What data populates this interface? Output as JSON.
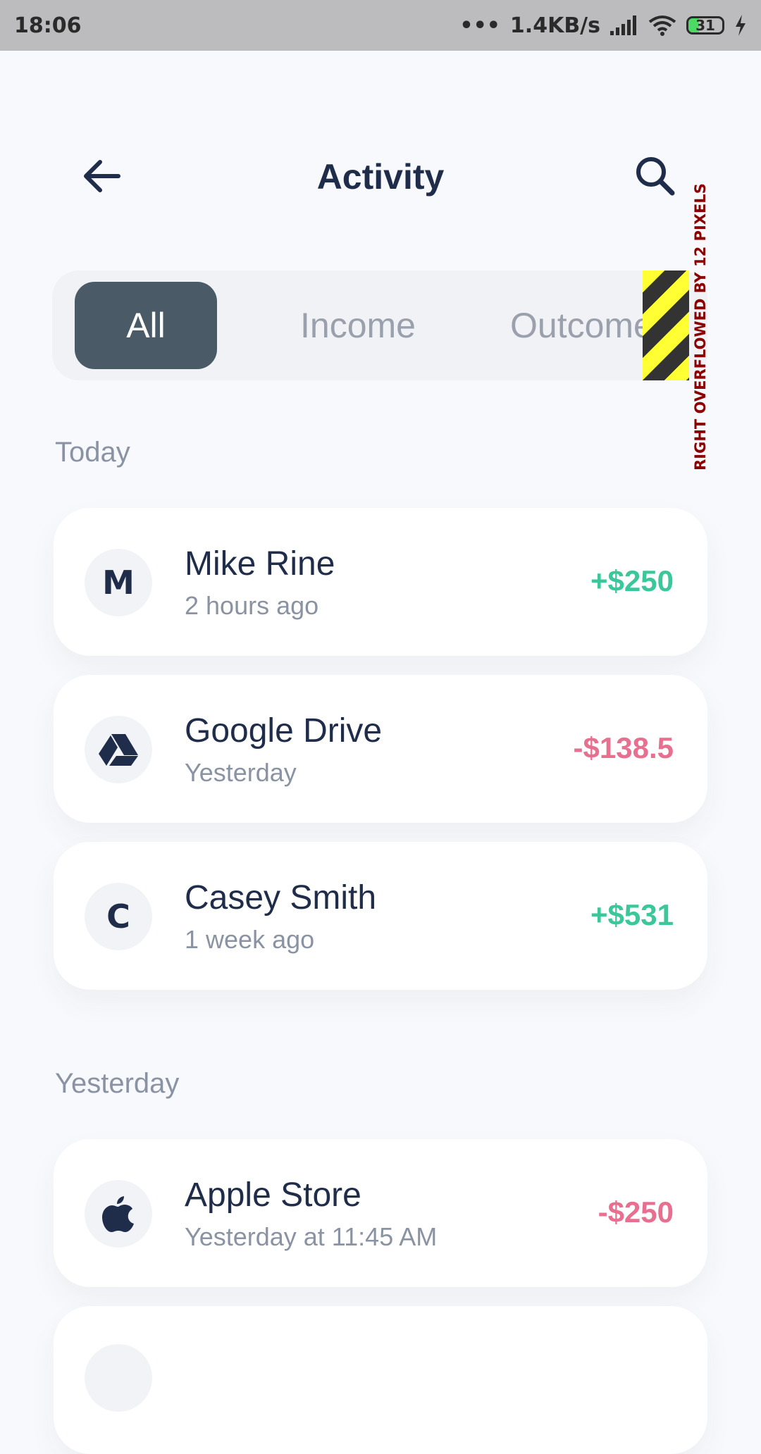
{
  "status_bar": {
    "time": "18:06",
    "net_speed": "1.4KB/s",
    "battery": "31"
  },
  "header": {
    "title": "Activity"
  },
  "tabs": [
    {
      "label": "All",
      "active": true
    },
    {
      "label": "Income",
      "active": false
    },
    {
      "label": "Outcome",
      "active": false
    }
  ],
  "overflow_warning": "RIGHT OVERFLOWED BY 12 PIXELS",
  "sections": [
    {
      "label": "Today",
      "items": [
        {
          "name": "Mike Rine",
          "time": "2 hours ago",
          "amount": "+$250",
          "avatar": "M",
          "icon": "letter-avatar"
        },
        {
          "name": "Google Drive",
          "time": "Yesterday",
          "amount": "-$138.5",
          "icon": "google-drive-icon"
        },
        {
          "name": "Casey Smith",
          "time": "1 week ago",
          "amount": "+$531",
          "avatar": "C",
          "icon": "letter-avatar"
        }
      ]
    },
    {
      "label": "Yesterday",
      "items": [
        {
          "name": "Apple Store",
          "time": "Yesterday at 11:45 AM",
          "amount": "-$250",
          "icon": "apple-icon"
        }
      ]
    }
  ],
  "colors": {
    "income": "#3cc79a",
    "outcome": "#e76f8f",
    "active_tab": "#4a5a66",
    "title": "#1f2d4a"
  }
}
